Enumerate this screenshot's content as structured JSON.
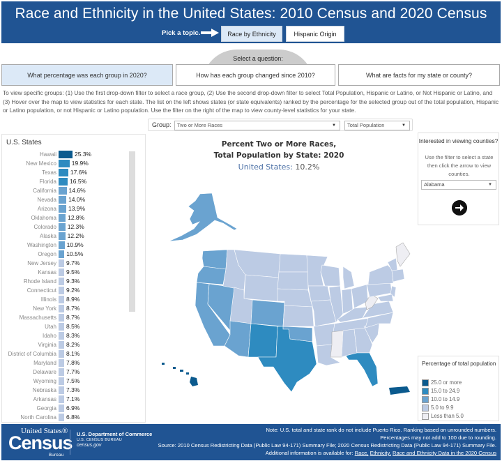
{
  "header": {
    "title": "Race and Ethnicity in the United States: 2010 Census and 2020 Census",
    "pick_label": "Pick a topic.",
    "topics": [
      {
        "label": "Race by Ethnicity",
        "selected": true
      },
      {
        "label": "Hispanic Origin",
        "selected": false
      }
    ]
  },
  "questions": {
    "label": "Select a question:",
    "items": [
      {
        "label": "What percentage was each group in 2020?",
        "selected": true
      },
      {
        "label": "How has each group changed since 2010?",
        "selected": false
      },
      {
        "label": "What are facts for my state or county?",
        "selected": false
      }
    ]
  },
  "instructions": "To view specific groups: (1) Use the first drop-down filter to select a race group, (2) Use the second drop-down filter to select Total Population, Hispanic or Latino, or Not Hispanic or Latino, and (3) Hover over the map to view statistics for each state. The list on the left shows states (or state equivalents) ranked by the percentage for the selected group out of the total population, Hispanic or Latino population, or not Hispanic or Latino population. Use the filter on the right of the map to view county-level statistics for your state.",
  "filters": {
    "group_label": "Group:",
    "group_value": "Two or More Races",
    "population_value": "Total Population"
  },
  "states_panel": {
    "title": "U.S. States",
    "rows": [
      {
        "name": "Hawaii",
        "value": 25.3,
        "label": "25.3%",
        "color": "#0b5a8e"
      },
      {
        "name": "New Mexico",
        "value": 19.9,
        "label": "19.9%",
        "color": "#2e8bc0"
      },
      {
        "name": "Texas",
        "value": 17.6,
        "label": "17.6%",
        "color": "#2e8bc0"
      },
      {
        "name": "Florida",
        "value": 16.5,
        "label": "16.5%",
        "color": "#2e8bc0"
      },
      {
        "name": "California",
        "value": 14.6,
        "label": "14.6%",
        "color": "#6aa3d0"
      },
      {
        "name": "Nevada",
        "value": 14.0,
        "label": "14.0%",
        "color": "#6aa3d0"
      },
      {
        "name": "Arizona",
        "value": 13.9,
        "label": "13.9%",
        "color": "#6aa3d0"
      },
      {
        "name": "Oklahoma",
        "value": 12.8,
        "label": "12.8%",
        "color": "#6aa3d0"
      },
      {
        "name": "Colorado",
        "value": 12.3,
        "label": "12.3%",
        "color": "#6aa3d0"
      },
      {
        "name": "Alaska",
        "value": 12.2,
        "label": "12.2%",
        "color": "#6aa3d0"
      },
      {
        "name": "Washington",
        "value": 10.9,
        "label": "10.9%",
        "color": "#6aa3d0"
      },
      {
        "name": "Oregon",
        "value": 10.5,
        "label": "10.5%",
        "color": "#6aa3d0"
      },
      {
        "name": "New Jersey",
        "value": 9.7,
        "label": "9.7%",
        "color": "#bccbe4"
      },
      {
        "name": "Kansas",
        "value": 9.5,
        "label": "9.5%",
        "color": "#bccbe4"
      },
      {
        "name": "Rhode Island",
        "value": 9.3,
        "label": "9.3%",
        "color": "#bccbe4"
      },
      {
        "name": "Connecticut",
        "value": 9.2,
        "label": "9.2%",
        "color": "#bccbe4"
      },
      {
        "name": "Illinois",
        "value": 8.9,
        "label": "8.9%",
        "color": "#bccbe4"
      },
      {
        "name": "New York",
        "value": 8.7,
        "label": "8.7%",
        "color": "#bccbe4"
      },
      {
        "name": "Massachusetts",
        "value": 8.7,
        "label": "8.7%",
        "color": "#bccbe4"
      },
      {
        "name": "Utah",
        "value": 8.5,
        "label": "8.5%",
        "color": "#bccbe4"
      },
      {
        "name": "Idaho",
        "value": 8.3,
        "label": "8.3%",
        "color": "#bccbe4"
      },
      {
        "name": "Virginia",
        "value": 8.2,
        "label": "8.2%",
        "color": "#bccbe4"
      },
      {
        "name": "District of Columbia",
        "value": 8.1,
        "label": "8.1%",
        "color": "#bccbe4"
      },
      {
        "name": "Maryland",
        "value": 7.8,
        "label": "7.8%",
        "color": "#bccbe4"
      },
      {
        "name": "Delaware",
        "value": 7.7,
        "label": "7.7%",
        "color": "#bccbe4"
      },
      {
        "name": "Wyoming",
        "value": 7.5,
        "label": "7.5%",
        "color": "#bccbe4"
      },
      {
        "name": "Nebraska",
        "value": 7.3,
        "label": "7.3%",
        "color": "#bccbe4"
      },
      {
        "name": "Arkansas",
        "value": 7.1,
        "label": "7.1%",
        "color": "#bccbe4"
      },
      {
        "name": "Georgia",
        "value": 6.9,
        "label": "6.9%",
        "color": "#bccbe4"
      },
      {
        "name": "North Carolina",
        "value": 6.8,
        "label": "6.8%",
        "color": "#bccbe4"
      }
    ]
  },
  "map": {
    "title_line1": "Percent Two or More Races,",
    "title_line2": "Total Population by State: 2020",
    "us_label": "United States:",
    "us_value": "10.2%"
  },
  "county_panel": {
    "title": "Interested in viewing counties?",
    "description": "Use the filter to select a state then click the arrow to view counties.",
    "state_value": "Alabama"
  },
  "legend": {
    "title": "Percentage of total population",
    "items": [
      {
        "label": "25.0 or more",
        "color": "#0b5a8e"
      },
      {
        "label": "15.0 to 24.9",
        "color": "#2e8bc0"
      },
      {
        "label": "10.0 to 14.9",
        "color": "#6aa3d0"
      },
      {
        "label": "5.0 to 9.9",
        "color": "#bccbe4"
      },
      {
        "label": "Less than 5.0",
        "color": "#eeeef3"
      }
    ]
  },
  "footer": {
    "logo_top": "United States®",
    "logo_main": "Census",
    "logo_bottom": "Bureau",
    "dept": "U.S. Department of Commerce",
    "bureau": "U.S. CENSUS BUREAU",
    "site": "census.gov",
    "note1": "Note: U.S. total and state rank do not include Puerto Rico. Ranking based on unrounded numbers.",
    "note2": "Percentages may not add to 100 due to rounding.",
    "source": "Source: 2010 Census Redistricting Data (Public Law 94-171) Summary File; 2020 Census Redistricting Data (Public Law 94-171) Summary File.",
    "additional": "Additional information is available for:",
    "links": [
      "Race,",
      "Ethnicity,",
      "Race and Ethnicity Data in the 2020 Census"
    ]
  }
}
